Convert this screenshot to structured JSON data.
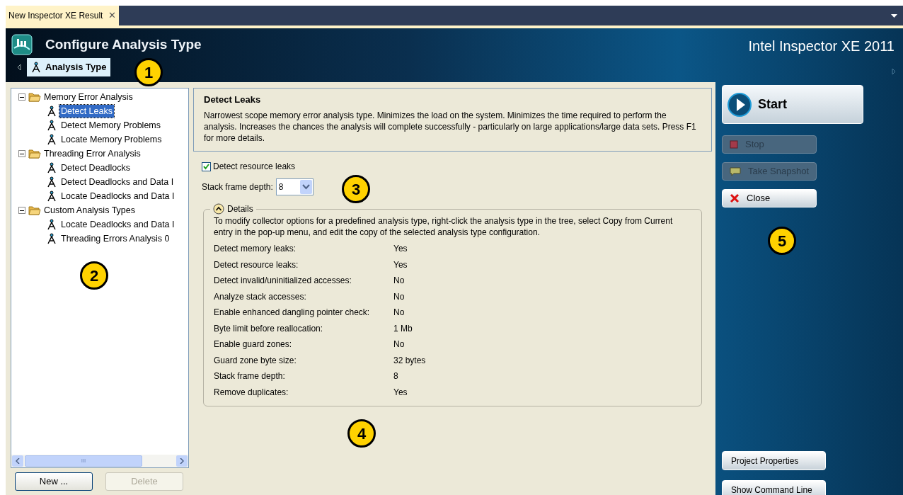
{
  "document_tab": {
    "title": "New Inspector XE Result",
    "close": "✕",
    "selected": true
  },
  "header": {
    "title": "Configure Analysis Type",
    "product": "Intel Inspector XE 2011",
    "breadcrumb": {
      "label": "Analysis Type",
      "selected": true
    }
  },
  "tree": {
    "items": [
      {
        "label": "Memory Error Analysis",
        "expanded": true,
        "children": [
          {
            "label": "Detect Leaks",
            "selected": true
          },
          {
            "label": "Detect Memory Problems",
            "selected": false
          },
          {
            "label": "Locate Memory Problems",
            "selected": false
          }
        ]
      },
      {
        "label": "Threading Error Analysis",
        "expanded": true,
        "children": [
          {
            "label": "Detect Deadlocks",
            "selected": false
          },
          {
            "label": "Detect Deadlocks and Data I",
            "selected": false
          },
          {
            "label": "Locate Deadlocks and Data I",
            "selected": false
          }
        ]
      },
      {
        "label": "Custom Analysis Types",
        "expanded": true,
        "children": [
          {
            "label": "Locate Deadlocks and Data I",
            "selected": false
          },
          {
            "label": "Threading Errors Analysis 0",
            "selected": false
          }
        ]
      }
    ],
    "scroll_grip": "III",
    "buttons": [
      {
        "label": "New ...",
        "disabled": false
      },
      {
        "label": "Delete",
        "disabled": true
      }
    ]
  },
  "description": {
    "title": "Detect Leaks",
    "text": "Narrowest scope memory error analysis type. Minimizes the load on the system. Minimizes the time required to perform the analysis. Increases the chances the analysis will complete successfully - particularly on large applications/large data sets. Press F1 for more details."
  },
  "options": {
    "checkbox": {
      "label": "Detect resource leaks",
      "checked": true
    },
    "stack_depth": {
      "label": "Stack frame depth:",
      "value": "8"
    }
  },
  "details": {
    "title": "Details",
    "expanded": true,
    "note": "To modify collector options for a predefined analysis type, right-click the analysis type in the tree, select Copy from Current entry in the pop-up menu, and edit the copy of the selected analysis type configuration.",
    "rows": [
      {
        "label": "Detect memory leaks:",
        "value": "Yes"
      },
      {
        "label": "Detect resource leaks:",
        "value": "Yes"
      },
      {
        "label": "Detect invalid/uninitialized accesses:",
        "value": "No"
      },
      {
        "label": "Analyze stack accesses:",
        "value": "No"
      },
      {
        "label": "Enable enhanced dangling pointer check:",
        "value": "No"
      },
      {
        "label": "Byte limit before reallocation:",
        "value": "1 Mb"
      },
      {
        "label": "Enable guard zones:",
        "value": "No"
      },
      {
        "label": "Guard zone byte size:",
        "value": "32 bytes"
      },
      {
        "label": "Stack frame depth:",
        "value": "8"
      },
      {
        "label": "Remove duplicates:",
        "value": "Yes"
      }
    ]
  },
  "actions": [
    {
      "label": "Start",
      "kind": "start",
      "disabled": false
    },
    {
      "label": "Stop",
      "kind": "stop",
      "disabled": true
    },
    {
      "label": "Take Snapshot",
      "kind": "snapshot",
      "disabled": true
    },
    {
      "label": "Close",
      "kind": "close",
      "disabled": false
    }
  ],
  "bottom_actions": [
    {
      "label": "Project Properties"
    },
    {
      "label": "Show Command Line"
    }
  ],
  "callouts": [
    "1",
    "2",
    "3",
    "4",
    "5"
  ]
}
